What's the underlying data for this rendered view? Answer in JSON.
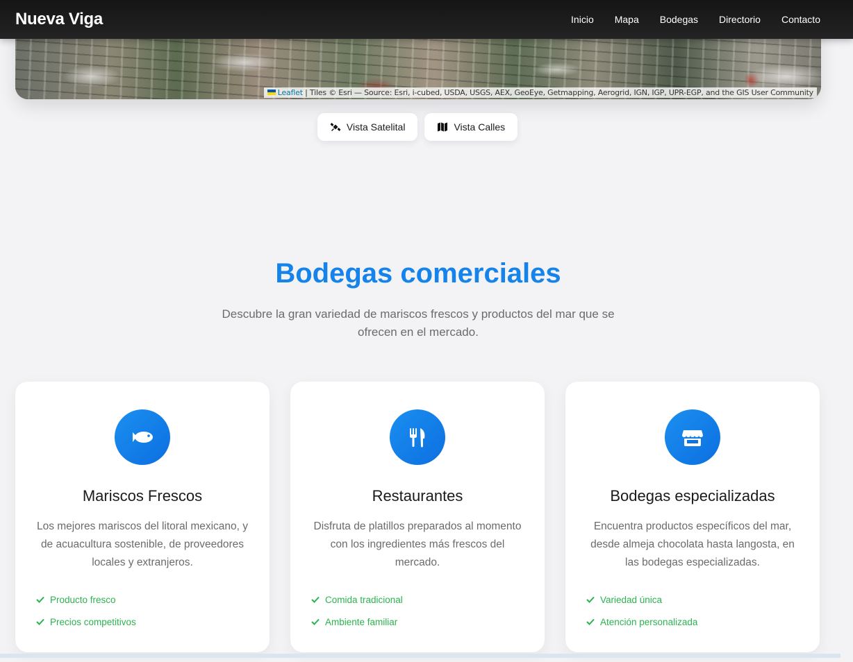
{
  "header": {
    "brand": "Nueva Viga",
    "nav": [
      "Inicio",
      "Mapa",
      "Bodegas",
      "Directorio",
      "Contacto"
    ]
  },
  "map": {
    "attribution_link": "Leaflet",
    "attribution_text": "| Tiles © Esri — Source: Esri, i-cubed, USDA, USGS, AEX, GeoEye, Getmapping, Aerogrid, IGN, IGP, UPR-EGP, and the GIS User Community"
  },
  "view_toggles": {
    "satellite": "Vista Satelital",
    "streets": "Vista Calles"
  },
  "section": {
    "title": "Bodegas comerciales",
    "subtitle": "Descubre la gran variedad de mariscos frescos y productos del mar que se ofrecen en el mercado."
  },
  "cards": [
    {
      "icon": "fish-icon",
      "title": "Mariscos Frescos",
      "description": "Los mejores mariscos del litoral mexicano, y de acuacultura sostenible, de proveedores locales y extranjeros.",
      "features": [
        "Producto fresco",
        "Precios competitivos"
      ]
    },
    {
      "icon": "utensils-icon",
      "title": "Restaurantes",
      "description": "Disfruta de platillos preparados al momento con los ingredientes más frescos del mercado.",
      "features": [
        "Comida tradicional",
        "Ambiente familiar"
      ]
    },
    {
      "icon": "store-icon",
      "title": "Bodegas especializadas",
      "description": "Encuentra productos específicos del mar, desde almeja chocolata hasta langosta, en las bodegas especializadas.",
      "features": [
        "Variedad única",
        "Atención personalizada"
      ]
    }
  ],
  "colors": {
    "accent": "#1583e9",
    "check": "#2bb34f",
    "header_bg": "#1a1a1a"
  }
}
